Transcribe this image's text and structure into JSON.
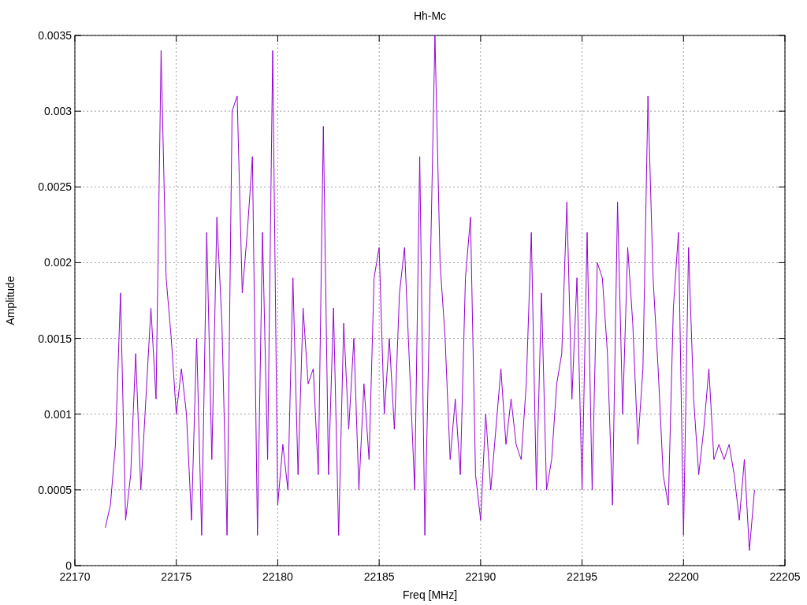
{
  "chart_data": {
    "type": "line",
    "title": "Hh-Mc",
    "xlabel": "Freq [MHz]",
    "ylabel": "Amplitude",
    "x": [
      22171.5,
      22171.75,
      22172,
      22172.25,
      22172.5,
      22172.75,
      22173,
      22173.25,
      22173.5,
      22173.75,
      22174,
      22174.25,
      22174.5,
      22174.75,
      22175,
      22175.25,
      22175.5,
      22175.75,
      22176,
      22176.25,
      22176.5,
      22176.75,
      22177,
      22177.25,
      22177.5,
      22177.75,
      22178,
      22178.25,
      22178.5,
      22178.75,
      22179,
      22179.25,
      22179.5,
      22179.75,
      22180,
      22180.25,
      22180.5,
      22180.75,
      22181,
      22181.25,
      22181.5,
      22181.75,
      22182,
      22182.25,
      22182.5,
      22182.75,
      22183,
      22183.25,
      22183.5,
      22183.75,
      22184,
      22184.25,
      22184.5,
      22184.75,
      22185,
      22185.25,
      22185.5,
      22185.75,
      22186,
      22186.25,
      22186.5,
      22186.75,
      22187,
      22187.25,
      22187.5,
      22187.75,
      22188,
      22188.25,
      22188.5,
      22188.75,
      22189,
      22189.25,
      22189.5,
      22189.75,
      22190,
      22190.25,
      22190.5,
      22190.75,
      22191,
      22191.25,
      22191.5,
      22191.75,
      22192,
      22192.25,
      22192.5,
      22192.75,
      22193,
      22193.25,
      22193.5,
      22193.75,
      22194,
      22194.25,
      22194.5,
      22194.75,
      22195,
      22195.25,
      22195.5,
      22195.75,
      22196,
      22196.25,
      22196.5,
      22196.75,
      22197,
      22197.25,
      22197.5,
      22197.75,
      22198,
      22198.25,
      22198.5,
      22198.75,
      22199,
      22199.25,
      22199.5,
      22199.75,
      22200,
      22200.25,
      22200.5,
      22200.75,
      22201,
      22201.25,
      22201.5,
      22201.75,
      22202,
      22202.25,
      22202.5,
      22202.75,
      22203,
      22203.25,
      22203.5
    ],
    "grid": true,
    "series": [
      {
        "color": "#9400d3",
        "values": [
          0.00025,
          0.0004,
          0.0008,
          0.0018,
          0.0003,
          0.0006,
          0.0014,
          0.0005,
          0.0011,
          0.0017,
          0.0011,
          0.0034,
          0.0019,
          0.0015,
          0.001,
          0.0013,
          0.001,
          0.0003,
          0.0015,
          0.0002,
          0.0022,
          0.0007,
          0.0023,
          0.0016,
          0.0002,
          0.003,
          0.0031,
          0.0018,
          0.0022,
          0.0027,
          0.0002,
          0.0022,
          0.0007,
          0.0034,
          0.0004,
          0.0008,
          0.0005,
          0.0019,
          0.0006,
          0.0017,
          0.0012,
          0.0013,
          0.0006,
          0.0029,
          0.0006,
          0.0017,
          0.0002,
          0.0016,
          0.0009,
          0.0015,
          0.0005,
          0.0012,
          0.0007,
          0.0019,
          0.0021,
          0.001,
          0.0015,
          0.0009,
          0.0018,
          0.0021,
          0.0013,
          0.0005,
          0.0027,
          0.0002,
          0.0018,
          0.0035,
          0.002,
          0.0015,
          0.0007,
          0.0011,
          0.0006,
          0.0019,
          0.0023,
          0.0006,
          0.0003,
          0.001,
          0.0005,
          0.0009,
          0.0013,
          0.0008,
          0.0011,
          0.0008,
          0.0007,
          0.0012,
          0.0022,
          0.0005,
          0.0018,
          0.0005,
          0.0007,
          0.0012,
          0.0014,
          0.0024,
          0.0011,
          0.0019,
          0.0005,
          0.0022,
          0.0005,
          0.002,
          0.0019,
          0.0014,
          0.0004,
          0.0024,
          0.001,
          0.0021,
          0.0016,
          0.0008,
          0.0013,
          0.0031,
          0.0019,
          0.0013,
          0.0006,
          0.0004,
          0.0017,
          0.0022,
          0.0002,
          0.0021,
          0.0011,
          0.0006,
          0.0009,
          0.0013,
          0.0007,
          0.0008,
          0.0007,
          0.0008,
          0.0006,
          0.0003,
          0.0007,
          0.0001,
          0.0005
        ]
      }
    ],
    "xlim": [
      22170,
      22205
    ],
    "ylim": [
      0,
      0.0035
    ],
    "xticks": [
      22170,
      22175,
      22180,
      22185,
      22190,
      22195,
      22200,
      22205
    ],
    "yticks": [
      0,
      0.0005,
      0.001,
      0.0015,
      0.002,
      0.0025,
      0.003,
      0.0035
    ]
  }
}
